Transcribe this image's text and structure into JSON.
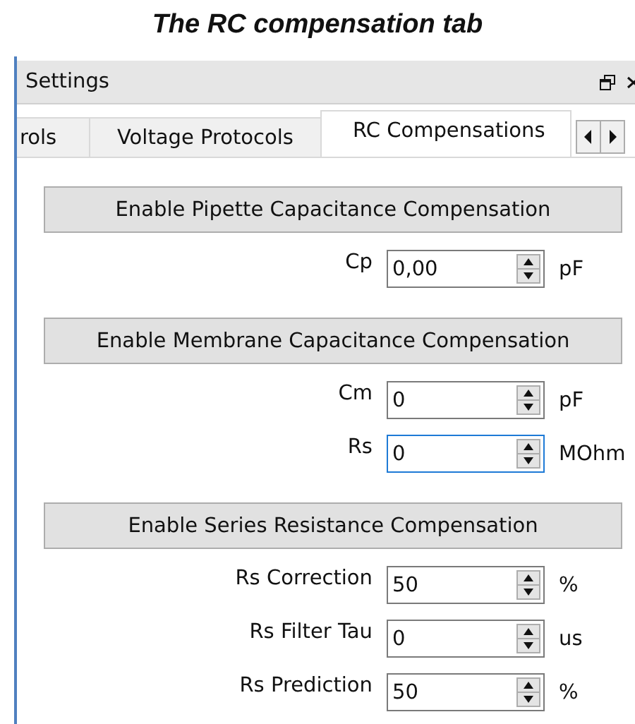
{
  "caption": "The RC compensation tab",
  "panel": {
    "title": "Settings",
    "tabs": [
      {
        "label": "rols",
        "selected": false
      },
      {
        "label": "Voltage Protocols",
        "selected": false
      },
      {
        "label": "RC Compensations",
        "selected": true
      }
    ]
  },
  "sections": [
    {
      "button": "Enable Pipette Capacitance Compensation",
      "fields": [
        {
          "label": "Cp",
          "value": "0,00",
          "unit": "pF",
          "focused": false
        }
      ]
    },
    {
      "button": "Enable Membrane Capacitance Compensation",
      "fields": [
        {
          "label": "Cm",
          "value": "0",
          "unit": "pF",
          "focused": false
        },
        {
          "label": "Rs",
          "value": "0",
          "unit": "MOhm",
          "focused": true
        }
      ]
    },
    {
      "button": "Enable Series Resistance Compensation",
      "fields": [
        {
          "label": "Rs Correction",
          "value": "50",
          "unit": "%",
          "focused": false
        },
        {
          "label": "Rs Filter Tau",
          "value": "0",
          "unit": "us",
          "focused": false
        },
        {
          "label": "Rs Prediction",
          "value": "50",
          "unit": "%",
          "focused": false
        }
      ]
    }
  ]
}
